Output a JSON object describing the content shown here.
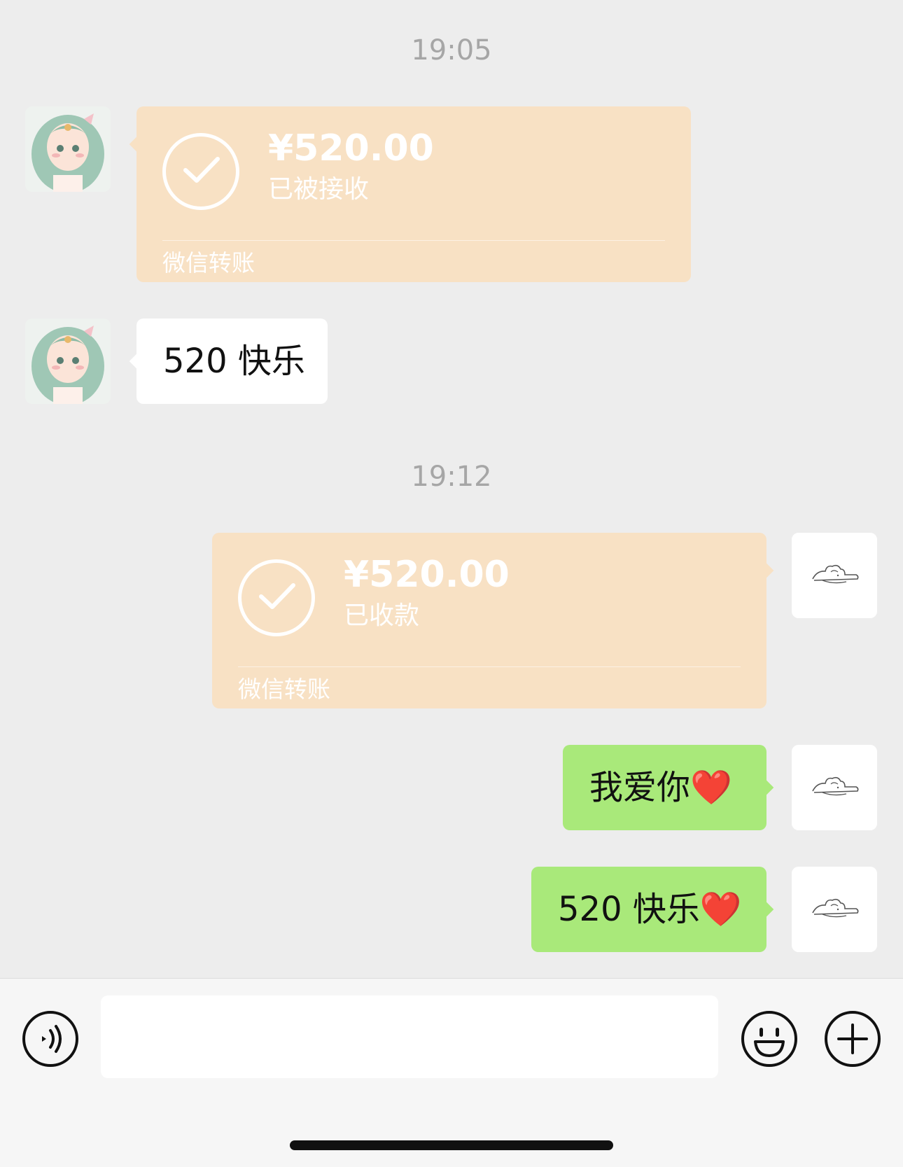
{
  "chat": {
    "timestamp_1": "19:05",
    "transfer_received": {
      "amount": "¥520.00",
      "status": "已被接收",
      "footer": "微信转账"
    },
    "incoming_text": "520 快乐",
    "timestamp_2": "19:12",
    "transfer_sent": {
      "amount": "¥520.00",
      "status": "已收款",
      "footer": "微信转账"
    },
    "outgoing_texts": [
      "我爱你❤️",
      "520 快乐❤️"
    ]
  },
  "input_bar": {
    "message_value": "",
    "icons": [
      "voice-icon",
      "emoji-icon",
      "plus-icon"
    ]
  },
  "colors": {
    "background": "#ededed",
    "transfer_bubble": "#f8e1c4",
    "outgoing_bubble": "#a9e97a",
    "incoming_bubble": "#ffffff",
    "timestamp_text": "#a6a6a6"
  }
}
